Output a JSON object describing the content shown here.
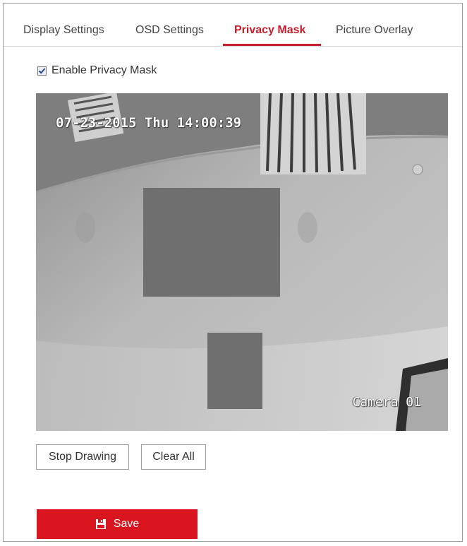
{
  "tabs": [
    {
      "label": "Display Settings",
      "active": false
    },
    {
      "label": "OSD Settings",
      "active": false
    },
    {
      "label": "Privacy Mask",
      "active": true
    },
    {
      "label": "Picture Overlay",
      "active": false
    }
  ],
  "privacy": {
    "enable_label": "Enable Privacy Mask",
    "enabled": true
  },
  "video": {
    "osd_datetime": "07-23-2015 Thu 14:00:39",
    "osd_camera": "Camera 01",
    "mask_color": "#6f6f6f"
  },
  "buttons": {
    "stop_drawing": "Stop Drawing",
    "clear_all": "Clear All",
    "save": "Save",
    "save_icon": "floppy-disk-icon"
  },
  "colors": {
    "accent": "#c51d2a",
    "save_bg": "#d9161f"
  }
}
